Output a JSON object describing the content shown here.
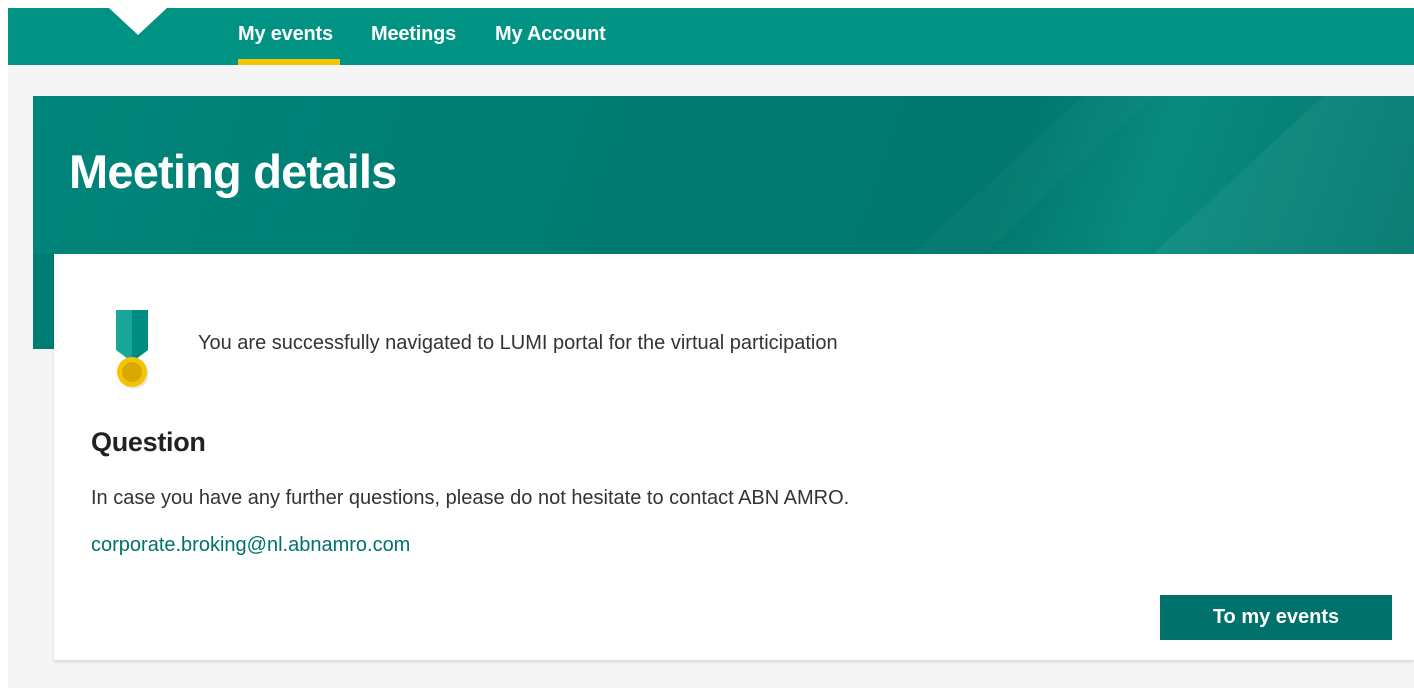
{
  "nav": {
    "items": [
      {
        "label": "My events",
        "active": true
      },
      {
        "label": "Meetings",
        "active": false
      },
      {
        "label": "My Account",
        "active": false
      }
    ]
  },
  "hero": {
    "title": "Meeting details"
  },
  "card": {
    "icon": "medal-icon",
    "success_message": "You are successfully navigated to LUMI portal for the virtual participation",
    "question_title": "Question",
    "question_text": "In case you have any further questions, please do not hesitate to contact ABN AMRO.",
    "contact_email": "corporate.broking@nl.abnamro.com",
    "button_label": "To my events"
  },
  "colors": {
    "nav_bg": "#009384",
    "nav_active_underline": "#f2c500",
    "hero_bg": "#007a70",
    "button_bg": "#00716b",
    "link": "#00716b"
  }
}
